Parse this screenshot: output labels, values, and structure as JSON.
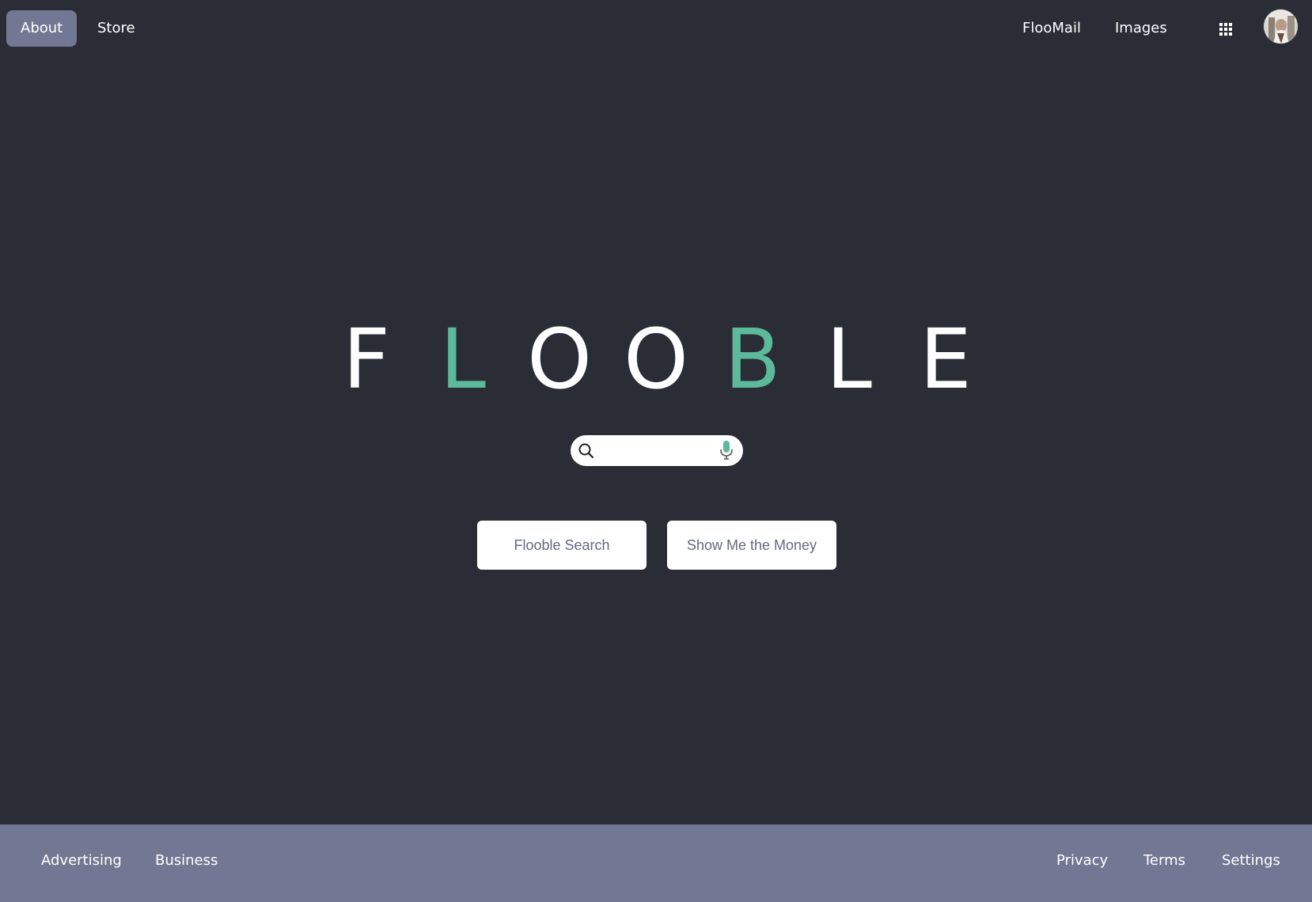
{
  "topbar": {
    "left_links": [
      "About",
      "Store"
    ],
    "right_links": [
      "FlooMail",
      "Images"
    ],
    "apps_icon": "grid-icon",
    "avatar_icon": "user-avatar"
  },
  "logo": {
    "letters": [
      "F",
      "L",
      "O",
      "O",
      "B",
      "L",
      "E"
    ],
    "accent_color": "#5cb99b",
    "base_color": "#ffffff"
  },
  "search": {
    "value": "",
    "placeholder": "",
    "search_icon": "search-icon",
    "mic_icon": "microphone-icon"
  },
  "buttons": {
    "search_label": "Flooble Search",
    "money_label": "Show Me the Money"
  },
  "footer": {
    "left_links": [
      "Advertising",
      "Business"
    ],
    "right_links": [
      "Privacy",
      "Terms",
      "Settings"
    ]
  },
  "colors": {
    "background": "#2a2d35",
    "active_nav": "#727893",
    "footer": "#727893",
    "button_text": "#646a80"
  }
}
